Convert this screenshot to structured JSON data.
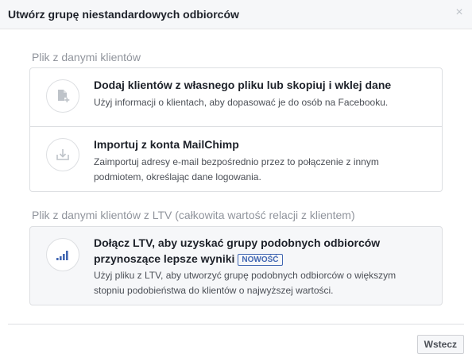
{
  "dialog": {
    "title": "Utwórz grupę niestandardowych odbiorców",
    "close_glyph": "×"
  },
  "section_customer_file": {
    "heading": "Plik z danymi klientów",
    "options": [
      {
        "title": "Dodaj klientów z własnego pliku lub skopiuj i wklej dane",
        "description": "Użyj informacji o klientach, aby dopasować je do osób na Facebooku.",
        "icon": "file-add-icon"
      },
      {
        "title": "Importuj z konta MailChimp",
        "description_line1": "Zaimportuj adresy e-mail bezpośrednio przez to połączenie z innym",
        "description_line2": "podmiotem, określając dane logowania.",
        "icon": "import-icon"
      }
    ]
  },
  "section_ltv": {
    "heading": "Plik z danymi klientów z LTV (całkowita wartość relacji z klientem)",
    "option": {
      "title_line1": "Dołącz LTV, aby uzyskać grupy podobnych odbiorców",
      "title_line2": "przynoszące lepsze wyniki",
      "badge": "NOWOŚĆ",
      "description_line1": "Użyj pliku z LTV, aby utworzyć grupę podobnych odbiorców o większym",
      "description_line2": "stopniu podobieństwa do klientów o najwyższej wartości.",
      "icon": "bar-chart-icon"
    }
  },
  "footer": {
    "back_label": "Wstecz"
  },
  "colors": {
    "accent": "#4267b2",
    "icon_gray": "#bec3c9",
    "text_dark": "#1d2129",
    "text_muted": "#90949c"
  }
}
